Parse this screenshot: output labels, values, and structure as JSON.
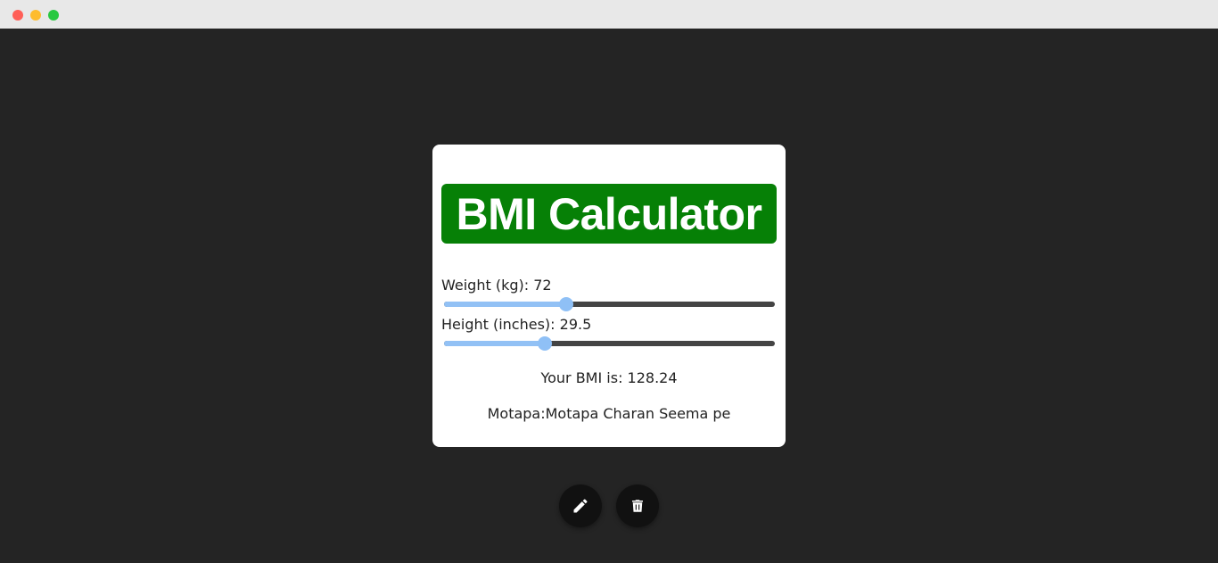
{
  "window": {
    "controls": [
      "close",
      "minimize",
      "maximize"
    ]
  },
  "calculator": {
    "title": "BMI Calculator",
    "weight": {
      "label": "Weight (kg): 72",
      "value": 72,
      "fraction": 0.37
    },
    "height": {
      "label": "Height (inches): 29.5",
      "value": 29.5,
      "fraction": 0.305
    },
    "bmi_text": "Your BMI is: 128.24",
    "status_text": "Motapa:Motapa Charan Seema pe"
  },
  "actions": [
    {
      "name": "edit",
      "icon": "pencil-icon"
    },
    {
      "name": "delete",
      "icon": "trash-icon"
    }
  ],
  "colors": {
    "background": "#242424",
    "title_bg": "#068006",
    "slider_fill": "#92c1f5",
    "slider_track": "#444444",
    "button_bg": "#111111"
  }
}
